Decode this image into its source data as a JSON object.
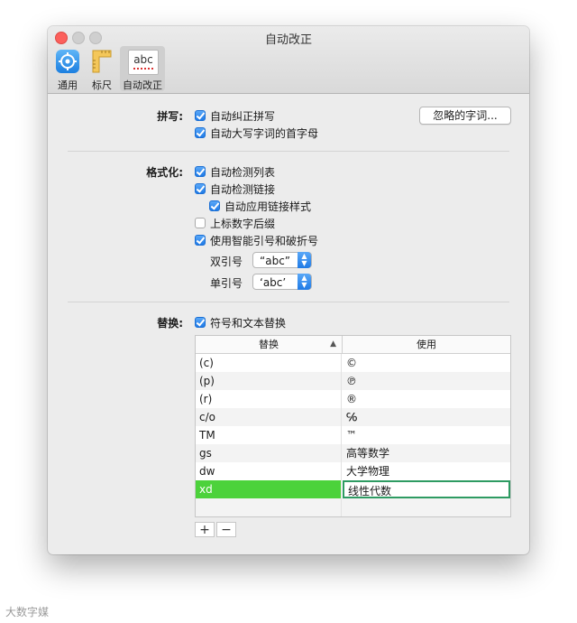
{
  "window": {
    "title": "自动改正"
  },
  "toolbar": {
    "items": [
      {
        "label": "通用",
        "icon": "gear-icon"
      },
      {
        "label": "标尺",
        "icon": "ruler-icon"
      },
      {
        "label": "自动改正",
        "icon": "abc-icon",
        "icon_text": "abc",
        "selected": true
      }
    ]
  },
  "spelling": {
    "label": "拼写:",
    "options": [
      {
        "label": "自动纠正拼写",
        "checked": true
      },
      {
        "label": "自动大写字词的首字母",
        "checked": true
      }
    ],
    "ignored_words_button": "忽略的字词..."
  },
  "formatting": {
    "label": "格式化:",
    "options": [
      {
        "label": "自动检测列表",
        "checked": true
      },
      {
        "label": "自动检测链接",
        "checked": true
      },
      {
        "label": "自动应用链接样式",
        "checked": true
      },
      {
        "label": "上标数字后缀",
        "checked": false
      },
      {
        "label": "使用智能引号和破折号",
        "checked": true
      }
    ],
    "double_quotes": {
      "label": "双引号",
      "value": "“abc”"
    },
    "single_quotes": {
      "label": "单引号",
      "value": "‘abc’"
    }
  },
  "replacement": {
    "label": "替换:",
    "option": {
      "label": "符号和文本替换",
      "checked": true
    },
    "columns": [
      "替换",
      "使用"
    ],
    "rows": [
      {
        "replace": "(c)",
        "with": "©"
      },
      {
        "replace": "(p)",
        "with": "℗"
      },
      {
        "replace": "(r)",
        "with": "®"
      },
      {
        "replace": "c/o",
        "with": "℅"
      },
      {
        "replace": "TM",
        "with": "™"
      },
      {
        "replace": "gs",
        "with": "高等数学"
      },
      {
        "replace": "dw",
        "with": "大学物理"
      },
      {
        "replace": "xd",
        "with": "线性代数",
        "selected": true
      }
    ],
    "add_label": "+",
    "remove_label": "−"
  },
  "watermark": "大数字媒"
}
